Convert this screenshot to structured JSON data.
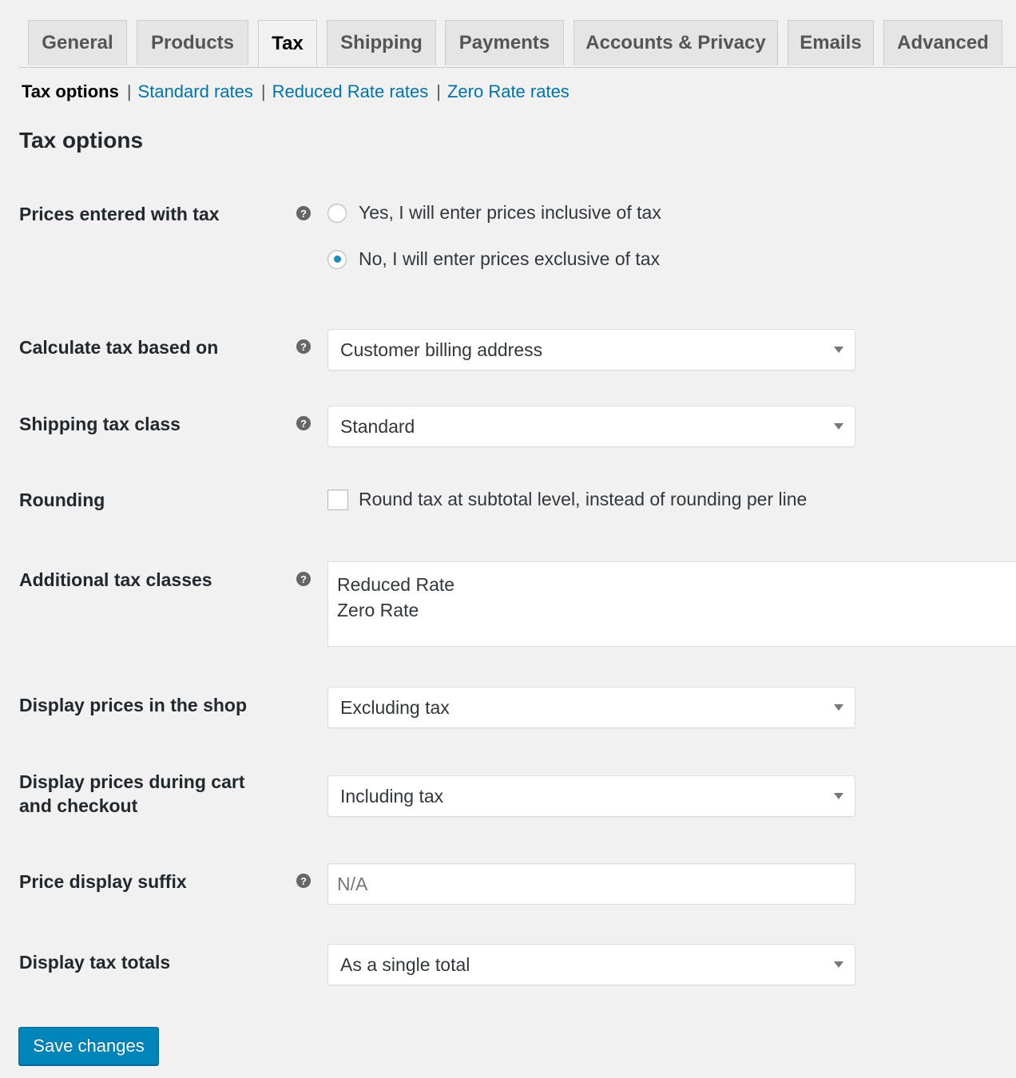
{
  "tabs": [
    {
      "label": "General",
      "active": false
    },
    {
      "label": "Products",
      "active": false
    },
    {
      "label": "Tax",
      "active": true
    },
    {
      "label": "Shipping",
      "active": false
    },
    {
      "label": "Payments",
      "active": false
    },
    {
      "label": "Accounts & Privacy",
      "active": false
    },
    {
      "label": "Emails",
      "active": false
    },
    {
      "label": "Advanced",
      "active": false
    }
  ],
  "subnav": {
    "current": "Tax options",
    "separator": "|",
    "links": [
      "Standard rates",
      "Reduced Rate rates",
      "Zero Rate rates"
    ]
  },
  "page_title": "Tax options",
  "help_icon_glyph": "?",
  "fields": {
    "prices_entered_with_tax": {
      "label": "Prices entered with tax",
      "options": [
        {
          "label": "Yes, I will enter prices inclusive of tax",
          "checked": false
        },
        {
          "label": "No, I will enter prices exclusive of tax",
          "checked": true
        }
      ]
    },
    "calculate_tax_based_on": {
      "label": "Calculate tax based on",
      "value": "Customer billing address"
    },
    "shipping_tax_class": {
      "label": "Shipping tax class",
      "value": "Standard"
    },
    "rounding": {
      "label": "Rounding",
      "checkbox_label": "Round tax at subtotal level, instead of rounding per line",
      "checked": false
    },
    "additional_tax_classes": {
      "label": "Additional tax classes",
      "lines": [
        "Reduced Rate",
        "Zero Rate"
      ]
    },
    "display_prices_in_shop": {
      "label": "Display prices in the shop",
      "value": "Excluding tax"
    },
    "display_prices_cart": {
      "label_line1": "Display prices during cart",
      "label_line2": "and checkout",
      "value": "Including tax"
    },
    "price_display_suffix": {
      "label": "Price display suffix",
      "value": "",
      "placeholder": "N/A"
    },
    "display_tax_totals": {
      "label": "Display tax totals",
      "value": "As a single total"
    }
  },
  "save_button": "Save changes",
  "colors": {
    "accent": "#0085ba",
    "link": "#0073aa",
    "radio_checked": "#1e8cbe",
    "background": "#f1f1f1"
  }
}
